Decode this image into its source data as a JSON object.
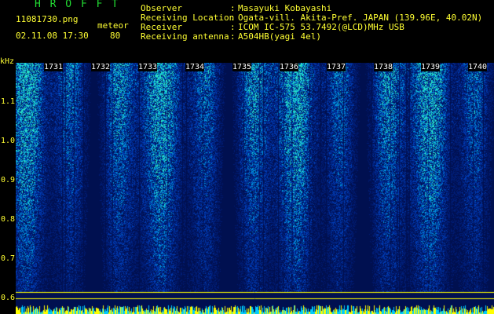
{
  "header": {
    "title": "H R O F F T",
    "filename": "11081730.png",
    "meteor_label": "meteor",
    "meteor_count": "80",
    "datetime": "02.11.08 17:30",
    "rows": [
      {
        "label": "Observer",
        "value": "Masayuki Kobayashi"
      },
      {
        "label": "Receiving Location",
        "value": "Ogata-vill. Akita-Pref. JAPAN (139.96E, 40.02N)"
      },
      {
        "label": "Receiver",
        "value": "ICOM IC-575 53.7492(@LCD)MHz USB"
      },
      {
        "label": "Receiving antenna",
        "value": "A504HB(yagi 4el)"
      }
    ]
  },
  "axis": {
    "unit": "kHz",
    "y_ticks": [
      "1.1",
      "1.0",
      "0.9",
      "0.8",
      "0.7",
      "0.6"
    ],
    "y_values": [
      1.1,
      1.0,
      0.9,
      0.8,
      0.7,
      0.6
    ],
    "y_range": [
      0.56,
      1.2
    ],
    "time_ticks": [
      "1731",
      "1732",
      "1733",
      "1734",
      "1735",
      "1736",
      "1737",
      "1738",
      "1739",
      "1740"
    ]
  },
  "colors": {
    "label_yellow": "#ffff33",
    "title_green": "#22dd33",
    "background_blue": "#001050",
    "baseline_yellow": "#ffff00",
    "noise_cyan": "#33ffcc"
  }
}
